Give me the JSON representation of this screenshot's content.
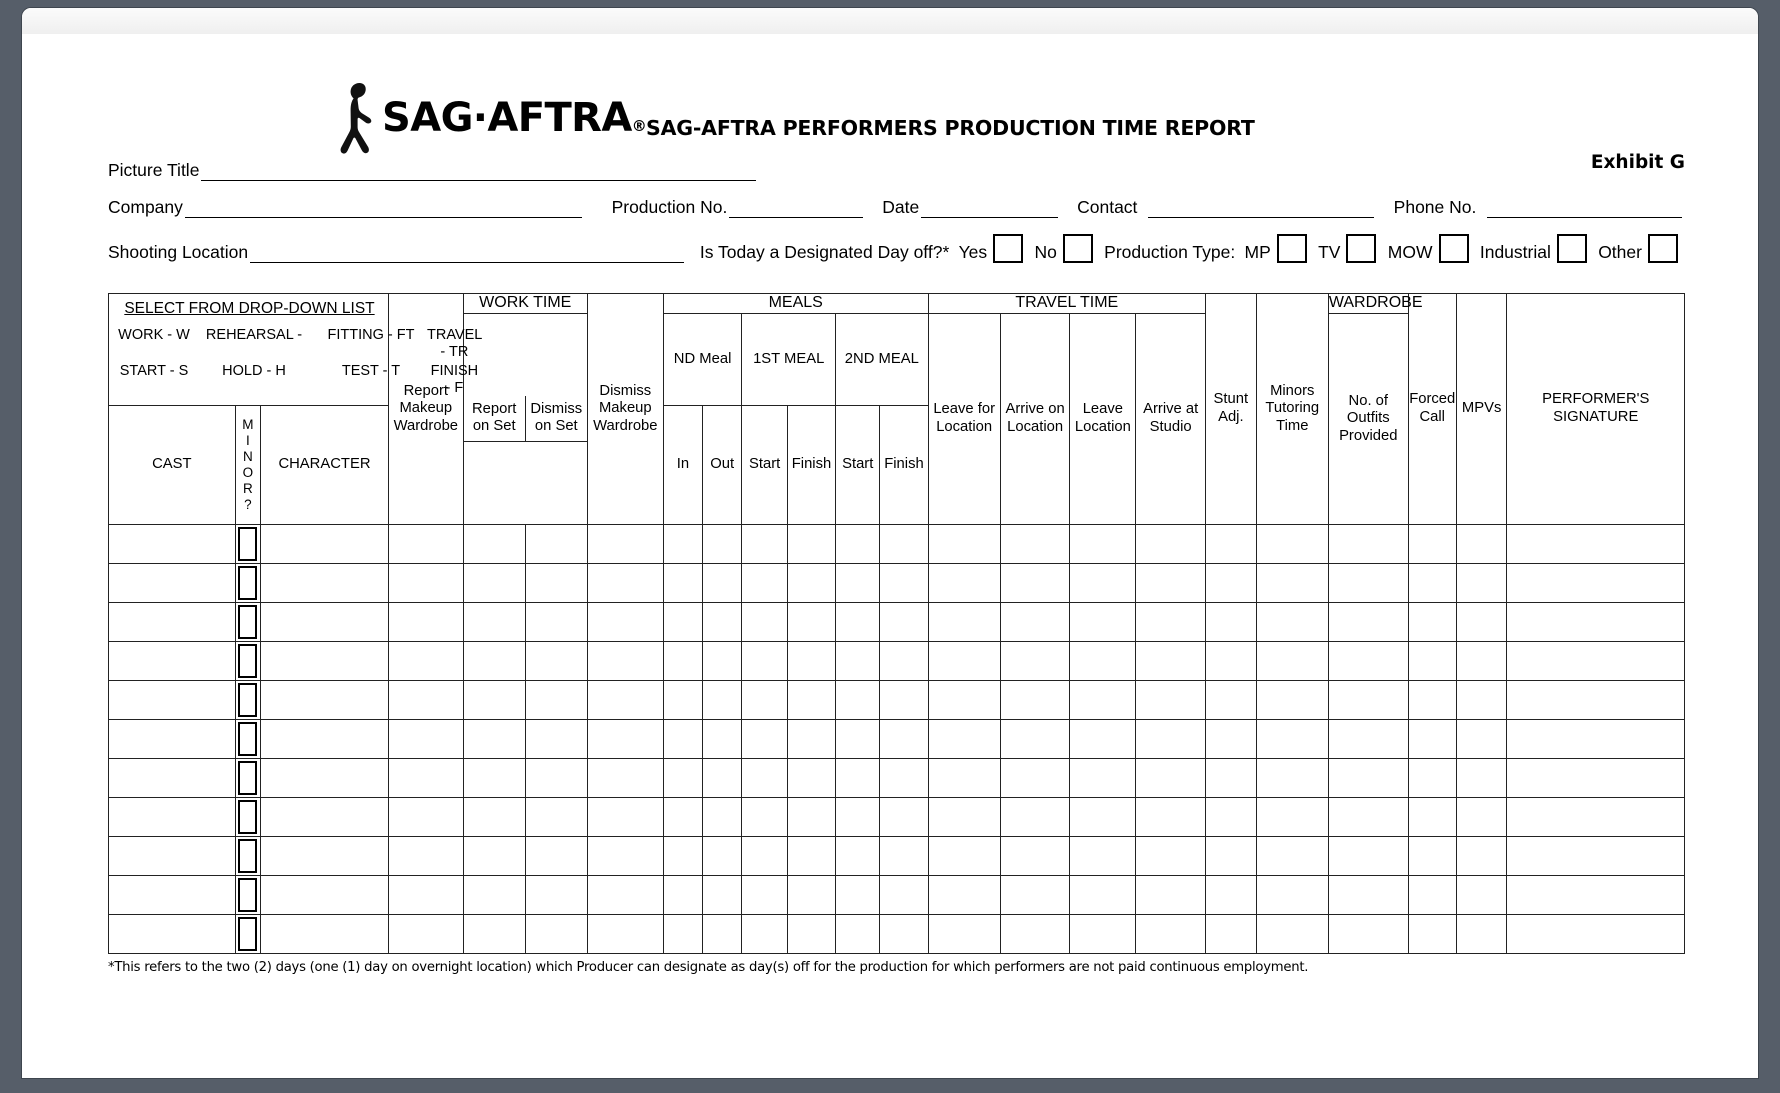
{
  "masthead": {
    "logo_text": "SAG·AFTRA",
    "logo_registered": "®",
    "report_title": "SAG-AFTRA PERFORMERS PRODUCTION TIME REPORT",
    "exhibit": "Exhibit G"
  },
  "form": {
    "picture_title_label": "Picture Title",
    "picture_title_value": "",
    "company_label": "Company",
    "company_value": "",
    "production_no_label": "Production No.",
    "production_no_value": "",
    "date_label": "Date",
    "date_value": "",
    "contact_label": "Contact",
    "contact_value": "",
    "phone_no_label": "Phone No.",
    "phone_no_value": "",
    "shooting_location_label": "Shooting Location",
    "shooting_location_value": "",
    "day_off_question": "Is Today a Designated Day off?*",
    "yes_label": "Yes",
    "no_label": "No",
    "production_type_label": "Production Type:",
    "types": [
      "MP",
      "TV",
      "MOW",
      "Industrial",
      "Other"
    ]
  },
  "dropdown_legend": {
    "title": "SELECT FROM DROP-DOWN LIST",
    "items": [
      "WORK - W",
      "REHEARSAL -",
      "FITTING - FT",
      "TRAVEL - TR",
      "START - S",
      "HOLD - H",
      "TEST - T",
      "FINISH - F"
    ]
  },
  "table": {
    "group_headers": {
      "work_time": "WORK TIME",
      "meals": "MEALS",
      "travel_time": "TRAVEL TIME",
      "wardrobe": "WARDROBE"
    },
    "meal_subheaders": [
      "ND Meal",
      "1ST MEAL",
      "2ND MEAL"
    ],
    "columns": [
      "CAST",
      "MINOR?",
      "CHARACTER",
      "Report Makeup Wardrobe",
      "Report on Set",
      "Dismiss on Set",
      "Dismiss Makeup Wardrobe",
      "In",
      "Out",
      "Start",
      "Finish",
      "Start",
      "Finish",
      "Leave for Location",
      "Arrive on Location",
      "Leave Location",
      "Arrive at Studio",
      "Stunt Adj.",
      "Minors Tutoring Time",
      "No. of Outfits Provided",
      "Forced Call",
      "MPVs",
      "PERFORMER'S SIGNATURE"
    ],
    "column_lines": {
      "cast": [
        "CAST"
      ],
      "minor": [
        "M",
        "I",
        "N",
        "O",
        "R",
        "?"
      ],
      "character": [
        "CHARACTER"
      ],
      "report_makeup_wardrobe": [
        "Report",
        "Makeup",
        "Wardrobe"
      ],
      "report_on_set": [
        "Report",
        "on Set"
      ],
      "dismiss_on_set": [
        "Dismiss",
        "on Set"
      ],
      "dismiss_makeup_wardrobe": [
        "Dismiss",
        "Makeup",
        "Wardrobe"
      ],
      "meal_nd_in": [
        "In"
      ],
      "meal_nd_out": [
        "Out"
      ],
      "meal1_start": [
        "Start"
      ],
      "meal1_finish": [
        "Finish"
      ],
      "meal2_start": [
        "Start"
      ],
      "meal2_finish": [
        "Finish"
      ],
      "leave_for_location": [
        "Leave for",
        "Location"
      ],
      "arrive_on_location": [
        "Arrive on",
        "Location"
      ],
      "leave_location": [
        "Leave",
        "Location"
      ],
      "arrive_at_studio": [
        "Arrive at",
        "Studio"
      ],
      "stunt_adj": [
        "Stunt",
        "Adj."
      ],
      "minors_tutoring_time": [
        "Minors",
        "Tutoring",
        "Time"
      ],
      "outfits_provided": [
        "No. of",
        "Outfits",
        "Provided"
      ],
      "forced_call": [
        "Forced",
        "Call"
      ],
      "mpvs": [
        "MPVs"
      ],
      "performers_signature": [
        "PERFORMER'S",
        "SIGNATURE"
      ]
    },
    "row_count": 11,
    "rows": [
      {
        "cast": "",
        "minor": false,
        "character": "",
        "signature": ""
      },
      {
        "cast": "",
        "minor": false,
        "character": "",
        "signature": ""
      },
      {
        "cast": "",
        "minor": false,
        "character": "",
        "signature": ""
      },
      {
        "cast": "",
        "minor": false,
        "character": "",
        "signature": ""
      },
      {
        "cast": "",
        "minor": false,
        "character": "",
        "signature": ""
      },
      {
        "cast": "",
        "minor": false,
        "character": "",
        "signature": ""
      },
      {
        "cast": "",
        "minor": false,
        "character": "",
        "signature": ""
      },
      {
        "cast": "",
        "minor": false,
        "character": "",
        "signature": ""
      },
      {
        "cast": "",
        "minor": false,
        "character": "",
        "signature": ""
      },
      {
        "cast": "",
        "minor": false,
        "character": "",
        "signature": ""
      },
      {
        "cast": "",
        "minor": false,
        "character": "",
        "signature": ""
      }
    ]
  },
  "footnote": "*This refers to the two (2) days (one (1) day on overnight location) which Producer can designate as day(s) off for the production for which performers are not paid continuous employment.",
  "colors": {
    "page_background": "#565e69",
    "sheet": "#ffffff",
    "ink": "#000000",
    "rule": "#222222"
  }
}
